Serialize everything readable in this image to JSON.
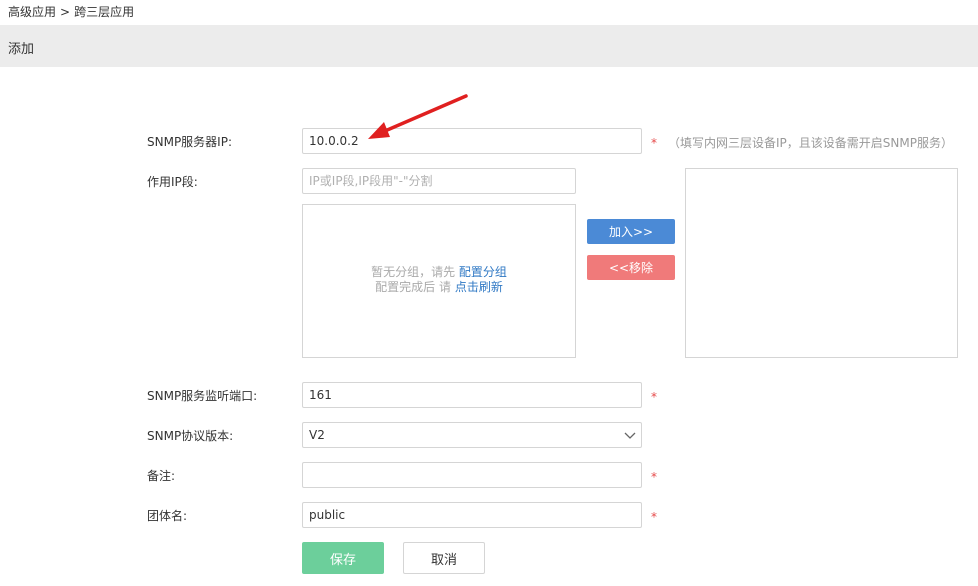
{
  "breadcrumb": {
    "parent": "高级应用",
    "separator": ">",
    "current": "跨三层应用"
  },
  "section_title": "添加",
  "form": {
    "snmp_ip": {
      "label": "SNMP服务器IP:",
      "value": "10.0.0.2",
      "required": "*",
      "hint": "（填写内网三层设备IP，且该设备需开启SNMP服务）"
    },
    "ip_range": {
      "label": "作用IP段:",
      "placeholder": "IP或IP段,IP段用\"-\"分割"
    },
    "group_panel": {
      "empty_text": "暂无分组，请先",
      "config_link": "配置分组",
      "after_text": "配置完成后 请",
      "refresh_link": "点击刷新"
    },
    "add_button": "加入>>",
    "remove_button": "<<移除",
    "port": {
      "label": "SNMP服务监听端口:",
      "value": "161",
      "required": "*"
    },
    "version": {
      "label": "SNMP协议版本:",
      "value": "V2"
    },
    "remark": {
      "label": "备注:",
      "value": "",
      "required": "*"
    },
    "community": {
      "label": "团体名:",
      "value": "public",
      "required": "*"
    }
  },
  "buttons": {
    "save": "保存",
    "cancel": "取消"
  },
  "colors": {
    "primary_blue": "#4b8ad6",
    "remove_red": "#f07a7a",
    "save_green": "#6ccf9b",
    "required_red": "#e64a4a",
    "annotation_arrow": "#e02020"
  }
}
